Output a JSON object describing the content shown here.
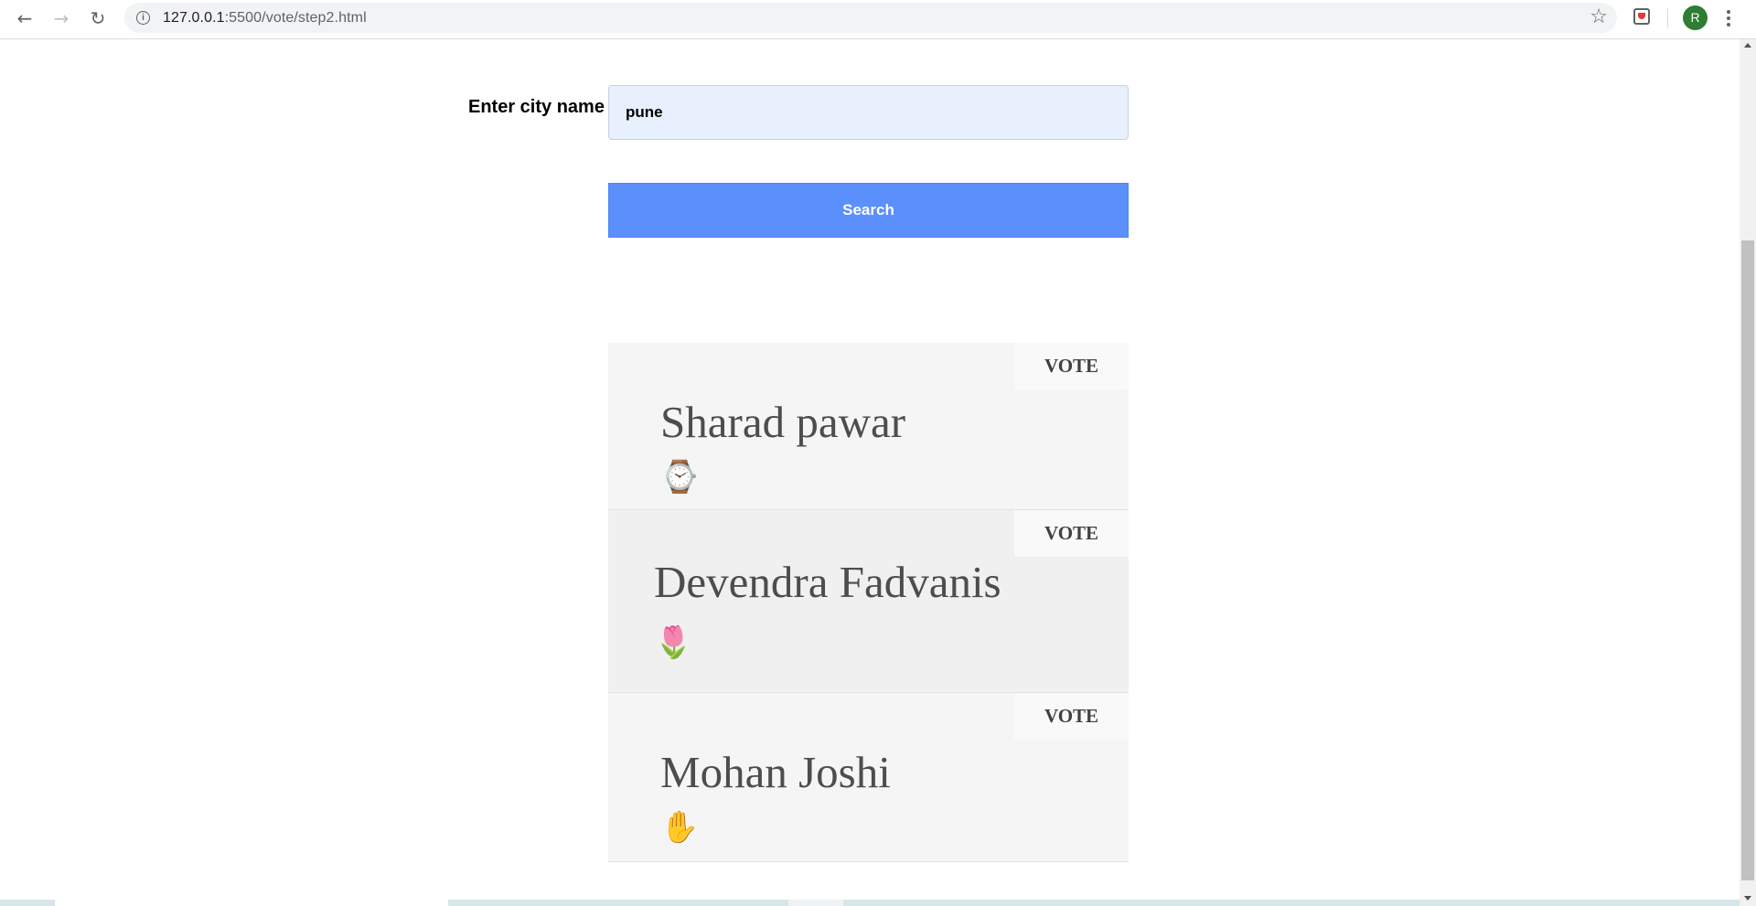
{
  "browser": {
    "url_host": "127.0.0.1",
    "url_path": ":5500/vote/step2.html",
    "avatar_letter": "R",
    "back_icon": "arrow-back-icon",
    "forward_icon": "arrow-forward-icon",
    "reload_icon": "reload-icon"
  },
  "form": {
    "city_label": "Enter city name",
    "city_value": "pune",
    "search_label": "Search"
  },
  "candidates": [
    {
      "name": "Sharad pawar",
      "symbol": "⌚",
      "symbol_name": "watch-icon",
      "vote_label": "VOTE"
    },
    {
      "name": "Devendra Fadvanis",
      "symbol": "🌷",
      "symbol_name": "lotus-icon",
      "vote_label": "VOTE"
    },
    {
      "name": "Mohan Joshi",
      "symbol": "✋",
      "symbol_name": "hand-icon",
      "vote_label": "VOTE"
    }
  ],
  "colors": {
    "search_button": "#5b8ffb",
    "input_background": "#e8f0fe"
  }
}
